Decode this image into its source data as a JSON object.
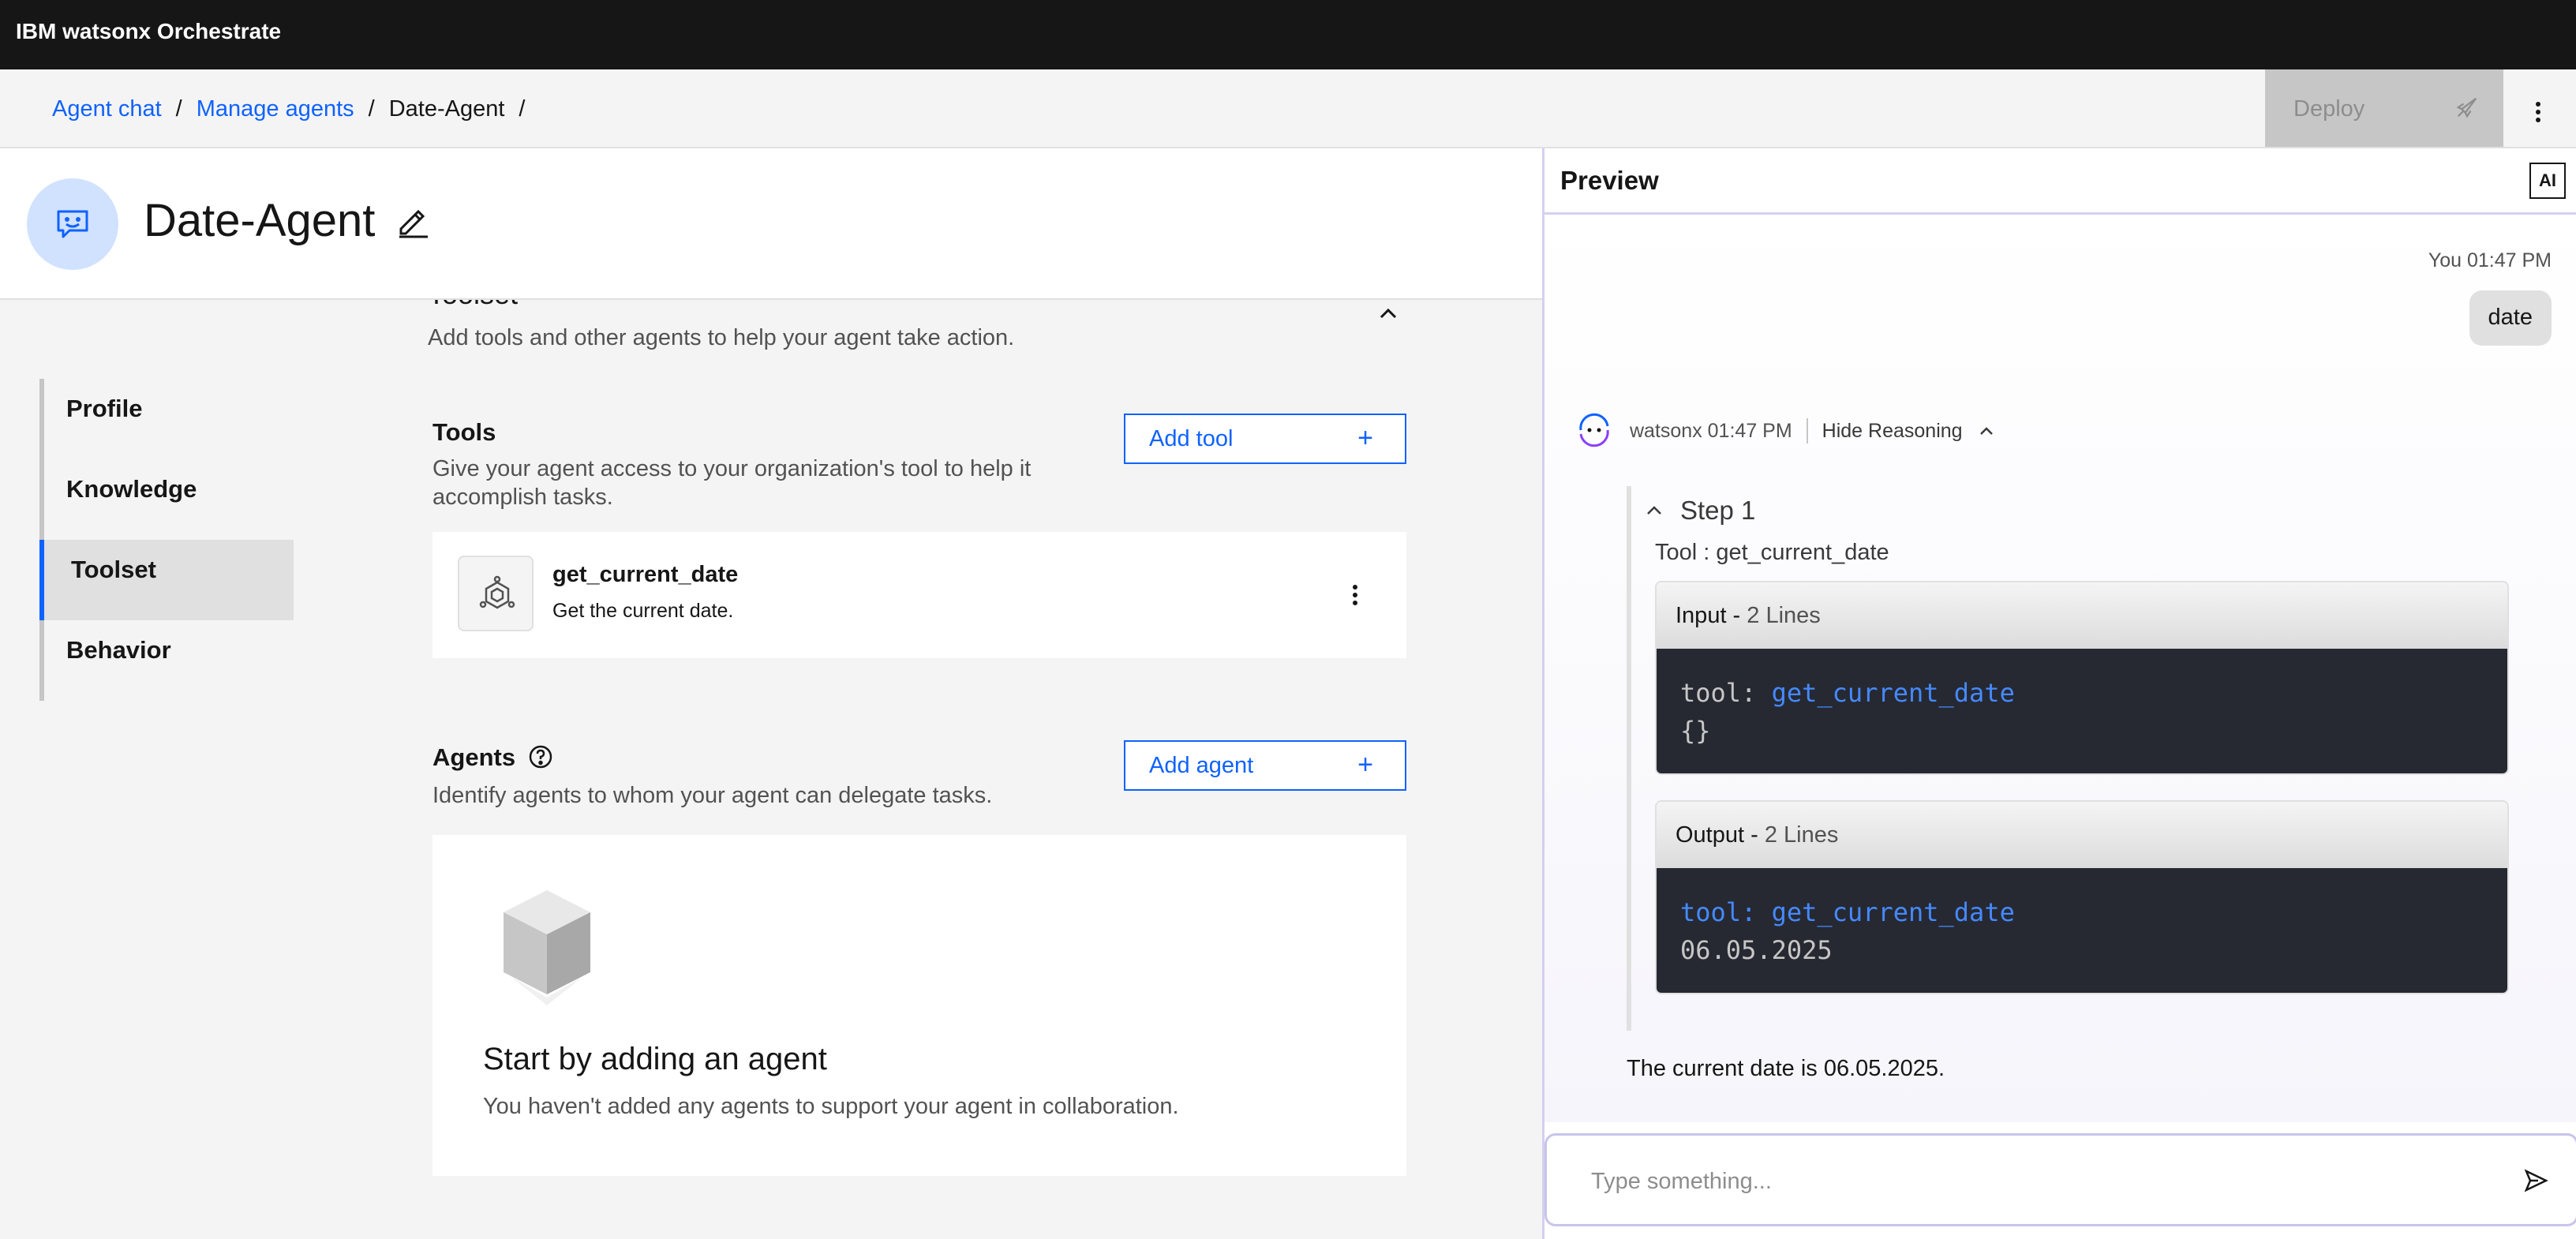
{
  "app": {
    "title": "IBM watsonx Orchestrate"
  },
  "breadcrumb": {
    "items": [
      {
        "label": "Agent chat"
      },
      {
        "label": "Manage agents"
      },
      {
        "label": "Date-Agent"
      }
    ],
    "separator": "/"
  },
  "toolbar": {
    "deploy_label": "Deploy"
  },
  "agent": {
    "name": "Date-Agent"
  },
  "sidenav": {
    "items": [
      {
        "label": "Profile",
        "active": false
      },
      {
        "label": "Knowledge",
        "active": false
      },
      {
        "label": "Toolset",
        "active": true
      },
      {
        "label": "Behavior",
        "active": false
      }
    ]
  },
  "toolset": {
    "title": "Toolset",
    "description": "Add tools and other agents to help your agent take action.",
    "tools": {
      "title": "Tools",
      "description": "Give your agent access to your organization's tool to help it accomplish tasks.",
      "add_label": "Add tool",
      "items": [
        {
          "name": "get_current_date",
          "description": "Get the current date."
        }
      ]
    },
    "agents": {
      "title": "Agents",
      "description": "Identify agents to whom your agent can delegate tasks.",
      "add_label": "Add agent",
      "empty_title": "Start by adding an agent",
      "empty_description": "You haven't added any agents to support your agent in collaboration."
    }
  },
  "preview": {
    "title": "Preview",
    "ai_badge": "AI",
    "user_message": {
      "meta": "You 01:47 PM",
      "text": "date"
    },
    "bot": {
      "meta": "watsonx 01:47 PM",
      "hide_reasoning": "Hide Reasoning",
      "step_label": "Step 1",
      "tool_line": "Tool : get_current_date",
      "input": {
        "label": "Input -",
        "count": "2 Lines",
        "line1_key": "tool:",
        "line1_value": "get_current_date",
        "line2": "{}"
      },
      "output": {
        "label": "Output -",
        "count": "2 Lines",
        "line1": "tool: get_current_date",
        "line2": "06.05.2025"
      },
      "answer": "The current date is 06.05.2025."
    },
    "input_placeholder": "Type something..."
  },
  "colors": {
    "accent": "#0f62fe",
    "topbar": "#161616",
    "code_bg": "#262932"
  }
}
